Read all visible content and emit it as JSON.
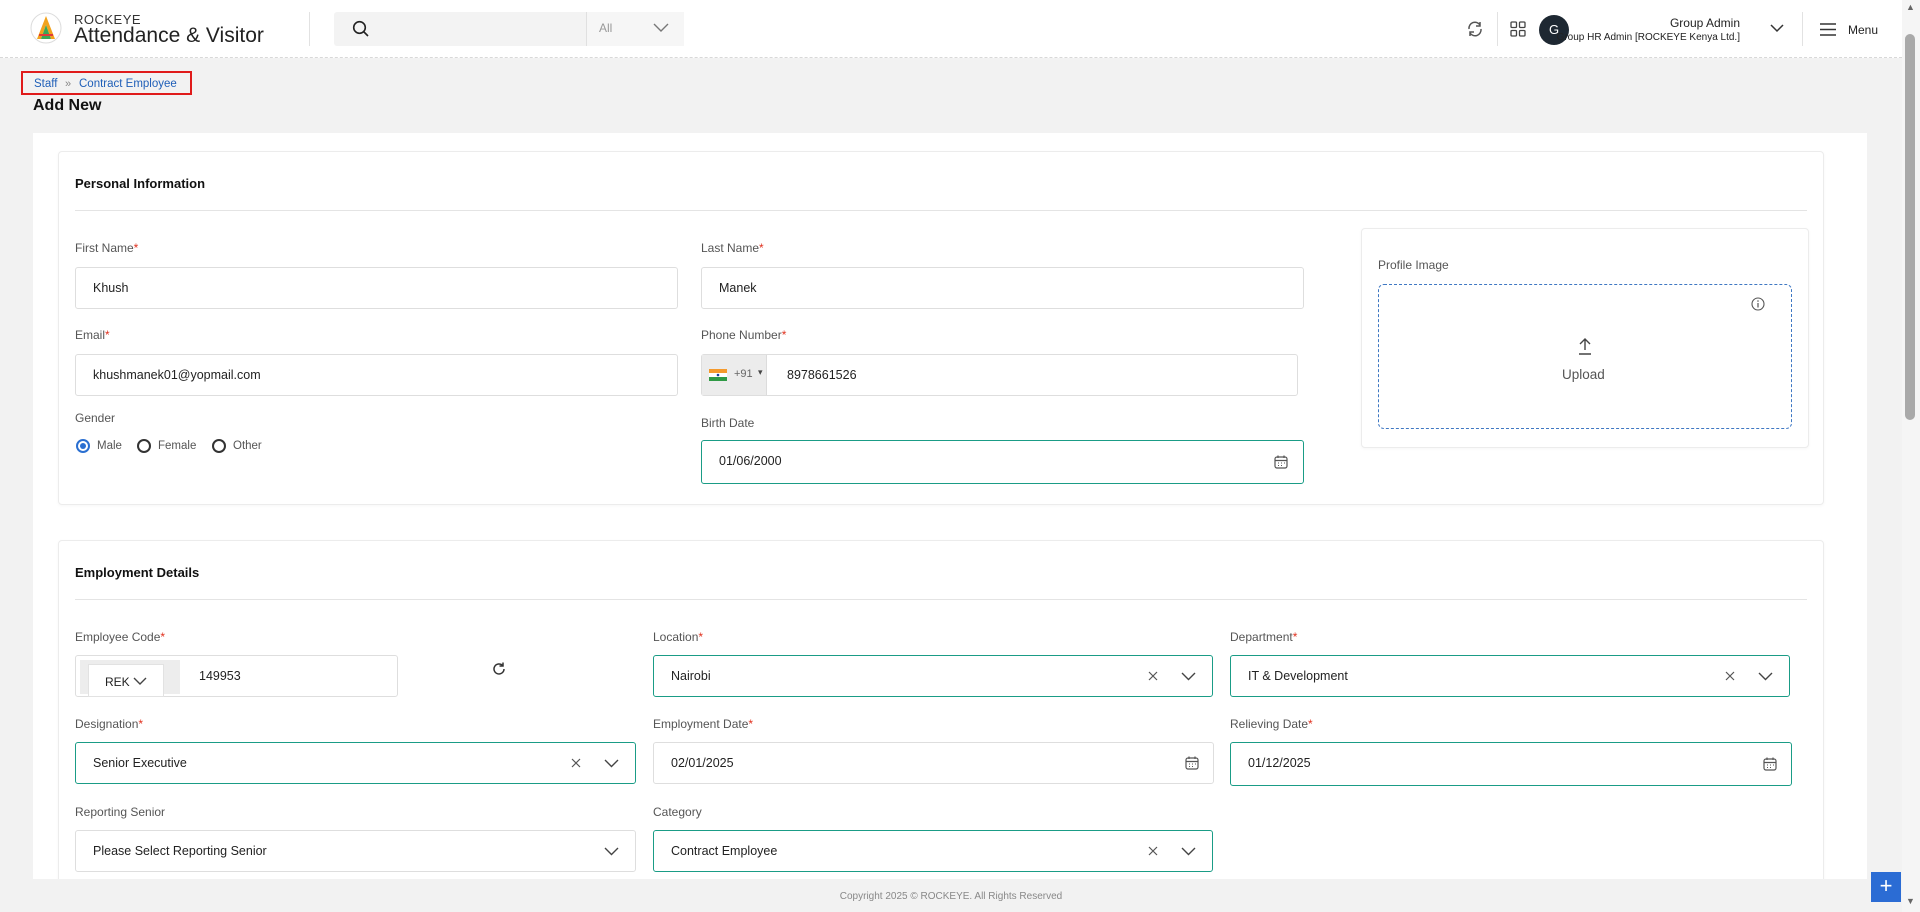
{
  "app": {
    "brand_top": "ROCKEYE",
    "brand_main": "Attendance & Visitor",
    "search": {
      "placeholder": "",
      "scope": "All"
    },
    "user": {
      "initial": "G",
      "name": "Group Admin",
      "role": "Group HR Admin [ROCKEYE Kenya Ltd.]"
    },
    "menu_label": "Menu"
  },
  "breadcrumb": [
    "Staff",
    "Contract Employee"
  ],
  "page_title": "Add New",
  "personal": {
    "title": "Personal Information",
    "first_name": {
      "label": "First Name",
      "value": "Khush"
    },
    "last_name": {
      "label": "Last Name",
      "value": "Manek"
    },
    "email": {
      "label": "Email",
      "value": "khushmanek01@yopmail.com"
    },
    "phone": {
      "label": "Phone Number",
      "code": "+91",
      "value": "8978661526"
    },
    "gender": {
      "label": "Gender",
      "options": [
        "Male",
        "Female",
        "Other"
      ],
      "selected": "Male"
    },
    "birth_date": {
      "label": "Birth Date",
      "value": "01/06/2000"
    },
    "profile": {
      "label": "Profile Image",
      "upload": "Upload"
    }
  },
  "employment": {
    "title": "Employment Details",
    "employee_code": {
      "label": "Employee Code",
      "prefix": "REK",
      "value": "149953"
    },
    "location": {
      "label": "Location",
      "value": "Nairobi"
    },
    "department": {
      "label": "Department",
      "value": "IT & Development"
    },
    "designation": {
      "label": "Designation",
      "value": "Senior Executive"
    },
    "employment_date": {
      "label": "Employment Date",
      "value": "02/01/2025"
    },
    "relieving_date": {
      "label": "Relieving Date",
      "value": "01/12/2025"
    },
    "reporting_senior": {
      "label": "Reporting Senior",
      "value": "Please Select Reporting Senior"
    },
    "category": {
      "label": "Category",
      "value": "Contract Employee"
    }
  },
  "footer": "Copyright 2025 © ROCKEYE. All Rights Reserved",
  "colors": {
    "accent": "#1a9c86",
    "link": "#1f5fb8",
    "required": "#e0311e",
    "fab": "#2b6cd4"
  }
}
